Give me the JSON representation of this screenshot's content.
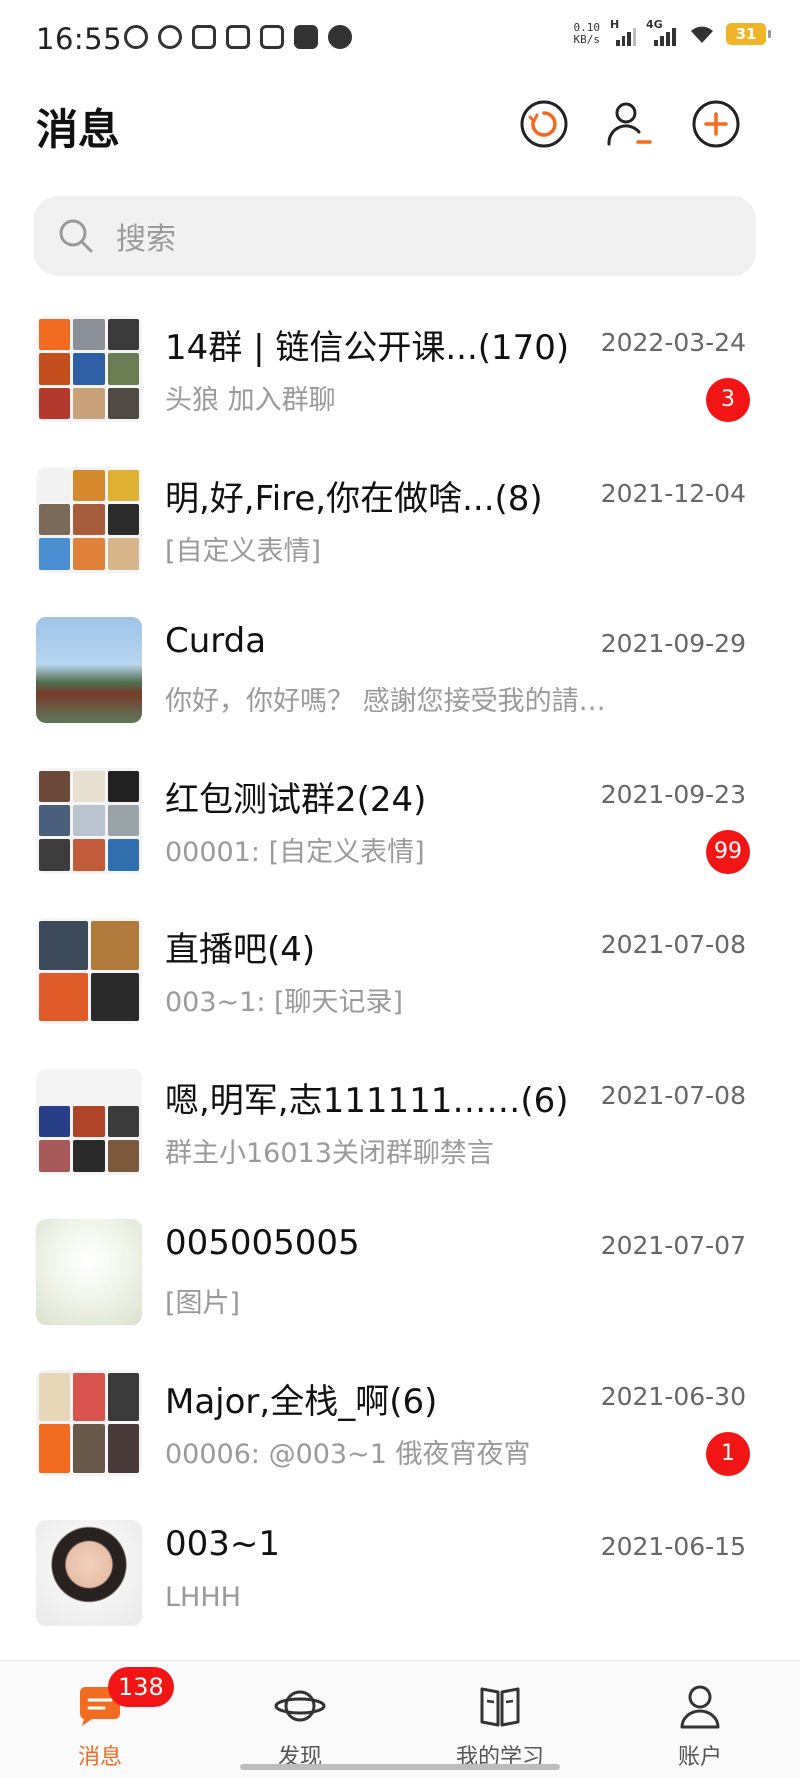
{
  "status_bar": {
    "time": "16:55",
    "net_speed_value": "0.10",
    "net_speed_unit": "KB/s",
    "signal1_label": "H",
    "signal2_label": "4G",
    "battery": "31",
    "battery_color": "#f0b429"
  },
  "header": {
    "title": "消息",
    "icons": [
      "refresh-circle-icon",
      "contacts-icon",
      "add-circle-icon"
    ],
    "accent_color": "#f26b21"
  },
  "search": {
    "placeholder": "搜索"
  },
  "conversations": [
    {
      "name": "14群 | 链信公开课...(170)",
      "date": "2022-03-24",
      "preview": "头狼 加入群聊",
      "badge": "3",
      "avatar": "group"
    },
    {
      "name": "明,好,Fire,你在做啥...(8)",
      "date": "2021-12-04",
      "preview": "[自定义表情]",
      "badge": "",
      "avatar": "group"
    },
    {
      "name": "Curda",
      "date": "2021-09-29",
      "preview": "你好，你好嗎？ 感謝您接受我的請…",
      "badge": "",
      "avatar": "photo"
    },
    {
      "name": "红包测试群2(24)",
      "date": "2021-09-23",
      "preview": "00001: [自定义表情]",
      "badge": "99",
      "avatar": "group"
    },
    {
      "name": "直播吧(4)",
      "date": "2021-07-08",
      "preview": "003~1: [聊天记录]",
      "badge": "",
      "avatar": "group"
    },
    {
      "name": "嗯,明军,志111111……(6)",
      "date": "2021-07-08",
      "preview": "群主小16013关闭群聊禁言",
      "badge": "",
      "avatar": "group"
    },
    {
      "name": "005005005",
      "date": "2021-07-07",
      "preview": "[图片]",
      "badge": "",
      "avatar": "photo"
    },
    {
      "name": "Major,全栈_啊(6)",
      "date": "2021-06-30",
      "preview": "00006: @003~1 俄夜宵夜宵",
      "badge": "1",
      "avatar": "group"
    },
    {
      "name": "003~1",
      "date": "2021-06-15",
      "preview": "LHHH",
      "badge": "",
      "avatar": "photo"
    }
  ],
  "tab_bar": {
    "tabs": [
      {
        "label": "消息",
        "icon": "message-icon",
        "active": true,
        "badge": "138"
      },
      {
        "label": "发现",
        "icon": "planet-icon",
        "active": false,
        "badge": ""
      },
      {
        "label": "我的学习",
        "icon": "book-icon",
        "active": false,
        "badge": ""
      },
      {
        "label": "账户",
        "icon": "person-icon",
        "active": false,
        "badge": ""
      }
    ]
  },
  "colors": {
    "badge": "#f21515",
    "accent": "#f26b21"
  }
}
